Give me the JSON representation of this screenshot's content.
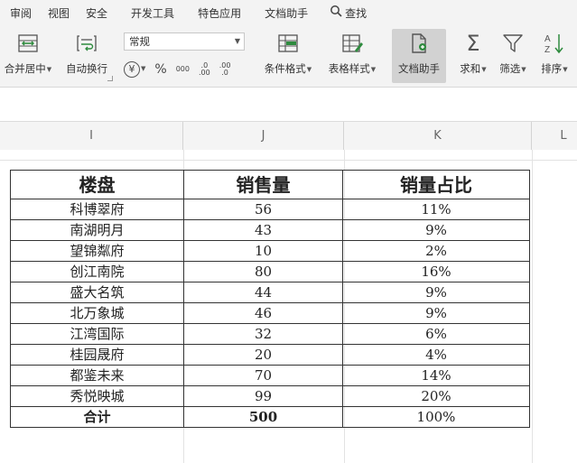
{
  "menu": {
    "items": [
      "审阅",
      "视图",
      "安全",
      "开发工具",
      "特色应用",
      "文档助手"
    ],
    "search_label": "查找"
  },
  "ribbon": {
    "merge_label": "合并居中",
    "wrap_label": "自动换行",
    "number_format": "常规",
    "currency_symbol": "¥",
    "percent_symbol": "%",
    "thousands_symbol": "000",
    "increase_decimal_top": ".0",
    "increase_decimal_bottom": ".00",
    "decrease_decimal_top": ".00",
    "decrease_decimal_bottom": ".0",
    "conditional_format_label": "条件格式",
    "table_style_label": "表格样式",
    "doc_assistant_label": "文档助手",
    "sum_label": "求和",
    "filter_label": "筛选",
    "sort_label": "排序"
  },
  "columns": [
    "I",
    "J",
    "K",
    "L"
  ],
  "table": {
    "headers": [
      "楼盘",
      "销售量",
      "销量占比"
    ],
    "rows": [
      [
        "科博翠府",
        "56",
        "11%"
      ],
      [
        "南湖明月",
        "43",
        "9%"
      ],
      [
        "望锦粼府",
        "10",
        "2%"
      ],
      [
        "创江南院",
        "80",
        "16%"
      ],
      [
        "盛大名筑",
        "44",
        "9%"
      ],
      [
        "北万象城",
        "46",
        "9%"
      ],
      [
        "江湾国际",
        "32",
        "6%"
      ],
      [
        "桂园晟府",
        "20",
        "4%"
      ],
      [
        "都鉴未来",
        "70",
        "14%"
      ],
      [
        "秀悦映城",
        "99",
        "20%"
      ]
    ],
    "total": [
      "合计",
      "500",
      "100%"
    ]
  },
  "colors": {
    "accent_green": "#2e8b3e",
    "icon_gray": "#555555",
    "active_button": "#d2d2d2"
  }
}
